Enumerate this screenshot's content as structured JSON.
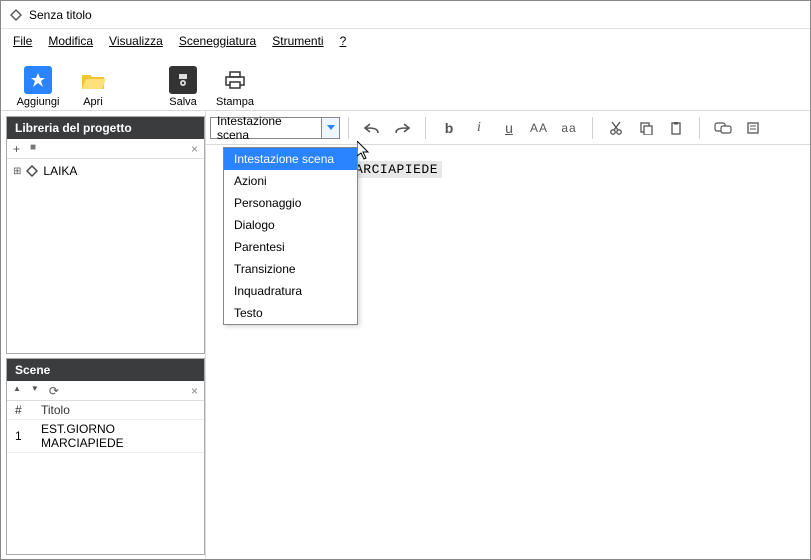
{
  "window": {
    "title": "Senza titolo"
  },
  "menu": {
    "file": "File",
    "modifica": "Modifica",
    "visualizza": "Visualizza",
    "sceneggiatura": "Sceneggiatura",
    "strumenti": "Strumenti",
    "help": "?"
  },
  "toolbar": {
    "add": "Aggiungi",
    "open": "Apri",
    "save": "Salva",
    "print": "Stampa"
  },
  "sidebar": {
    "library_title": "Libreria del progetto",
    "add_sym": "+",
    "folder_sym": "■",
    "close_sym": "×",
    "expand_sym": "⊞",
    "project_name": "LAIKA",
    "scene_title": "Scene",
    "up_sym": "▲",
    "down_sym": "▼",
    "refresh_sym": "⟳",
    "col_num": "#",
    "col_title": "Titolo",
    "row1_num": "1",
    "row1_title": "EST.GIORNO MARCIAPIEDE"
  },
  "format": {
    "combo_value": "Intestazione scena",
    "bold": "b",
    "italic": "i",
    "underline": "u",
    "upper": "AA",
    "lower": "aa"
  },
  "dropdown": {
    "items": [
      "Intestazione scena",
      "Azioni",
      "Personaggio",
      "Dialogo",
      "Parentesi",
      "Transizione",
      "Inquadratura",
      "Testo"
    ],
    "selected_index": 0
  },
  "editor": {
    "visible_text": "ARCIAPIEDE"
  }
}
